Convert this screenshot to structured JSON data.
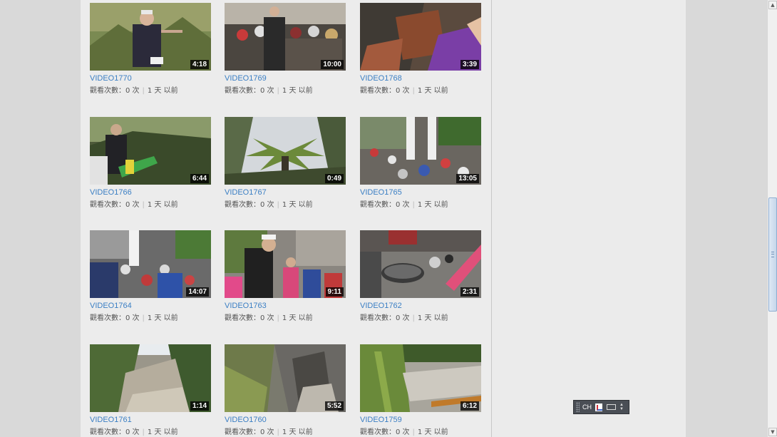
{
  "videos": [
    {
      "title": "VIDEO1770",
      "duration": "4:18",
      "views": "觀看次數：0 次",
      "age": "1 天 以前"
    },
    {
      "title": "VIDEO1769",
      "duration": "10:00",
      "views": "觀看次數：0 次",
      "age": "1 天 以前"
    },
    {
      "title": "VIDEO1768",
      "duration": "3:39",
      "views": "觀看次數：0 次",
      "age": "1 天 以前"
    },
    {
      "title": "VIDEO1766",
      "duration": "6:44",
      "views": "觀看次數：0 次",
      "age": "1 天 以前"
    },
    {
      "title": "VIDEO1767",
      "duration": "0:49",
      "views": "觀看次數：0 次",
      "age": "1 天 以前"
    },
    {
      "title": "VIDEO1765",
      "duration": "13:05",
      "views": "觀看次數：0 次",
      "age": "1 天 以前"
    },
    {
      "title": "VIDEO1764",
      "duration": "14:07",
      "views": "觀看次數：0 次",
      "age": "1 天 以前"
    },
    {
      "title": "VIDEO1763",
      "duration": "9:11",
      "views": "觀看次數：0 次",
      "age": "1 天 以前"
    },
    {
      "title": "VIDEO1762",
      "duration": "2:31",
      "views": "觀看次數：0 次",
      "age": "1 天 以前"
    },
    {
      "title": "VIDEO1761",
      "duration": "1:14",
      "views": "觀看次數：0 次",
      "age": "1 天 以前"
    },
    {
      "title": "VIDEO1760",
      "duration": "5:52",
      "views": "觀看次數：0 次",
      "age": "1 天 以前"
    },
    {
      "title": "VIDEO1759",
      "duration": "6:12",
      "views": "觀看次數：0 次",
      "age": "1 天 以前"
    }
  ],
  "language_bar": {
    "language": "CH"
  },
  "colors": {
    "title_link": "#3b7fc4",
    "meta_text": "#555555",
    "panel_bg": "#ececec",
    "page_bg": "#d9d9d9"
  }
}
